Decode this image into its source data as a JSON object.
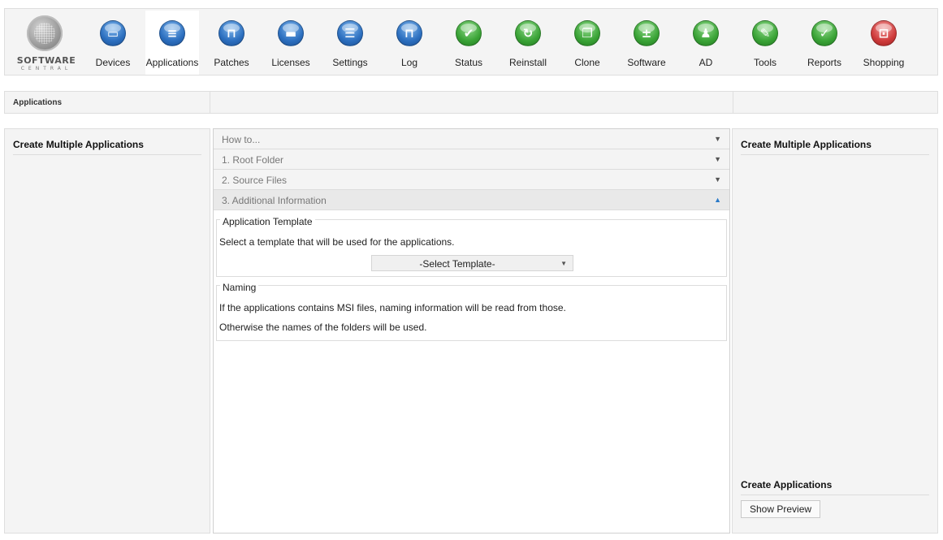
{
  "brand": {
    "line1": "SOFTWARE",
    "line2": "CENTRAL"
  },
  "toolbar": {
    "items": [
      {
        "label": "Devices",
        "icon": "monitor-icon",
        "color": "blue",
        "glyph": "▭"
      },
      {
        "label": "Applications",
        "icon": "applications-icon",
        "color": "blue",
        "glyph": "≡",
        "active": true
      },
      {
        "label": "Patches",
        "icon": "book-icon",
        "color": "blue",
        "glyph": "⊓"
      },
      {
        "label": "Licenses",
        "icon": "folder-icon",
        "color": "blue",
        "glyph": "▬"
      },
      {
        "label": "Settings",
        "icon": "checklist-icon",
        "color": "blue",
        "glyph": "☰"
      },
      {
        "label": "Log",
        "icon": "log-book-icon",
        "color": "blue",
        "glyph": "⊓"
      },
      {
        "label": "Status",
        "icon": "checkmark-icon",
        "color": "green",
        "glyph": "✔"
      },
      {
        "label": "Reinstall",
        "icon": "refresh-icon",
        "color": "green",
        "glyph": "↻"
      },
      {
        "label": "Clone",
        "icon": "clone-icon",
        "color": "green",
        "glyph": "❐"
      },
      {
        "label": "Software",
        "icon": "plus-minus-icon",
        "color": "green",
        "glyph": "±"
      },
      {
        "label": "AD",
        "icon": "users-icon",
        "color": "green",
        "glyph": "♟"
      },
      {
        "label": "Tools",
        "icon": "wrench-icon",
        "color": "green",
        "glyph": "✎"
      },
      {
        "label": "Reports",
        "icon": "clipboard-check-icon",
        "color": "green",
        "glyph": "✓"
      },
      {
        "label": "Shopping",
        "icon": "shopping-cart-icon",
        "color": "red",
        "glyph": "⊡"
      }
    ]
  },
  "breadcrumb": {
    "current": "Applications"
  },
  "left_panel": {
    "title": "Create Multiple Applications"
  },
  "accordion": {
    "sections": [
      {
        "label": "How to...",
        "open": false
      },
      {
        "label": "1. Root Folder",
        "open": false
      },
      {
        "label": "2. Source Files",
        "open": false
      },
      {
        "label": "3. Additional Information",
        "open": true
      }
    ]
  },
  "template_group": {
    "legend": "Application Template",
    "text": "Select a template that will be used for the applications.",
    "select_value": "-Select Template-"
  },
  "naming_group": {
    "legend": "Naming",
    "line1": "If the applications contains MSI files, naming information will be read from those.",
    "line2": "Otherwise the names of the folders will be used."
  },
  "right_panel": {
    "title": "Create Multiple Applications",
    "bottom_title": "Create Applications",
    "preview_button": "Show Preview"
  },
  "colors": {
    "accent": "#2a7ac8",
    "panel_bg": "#f4f4f4",
    "border": "#dedede"
  }
}
